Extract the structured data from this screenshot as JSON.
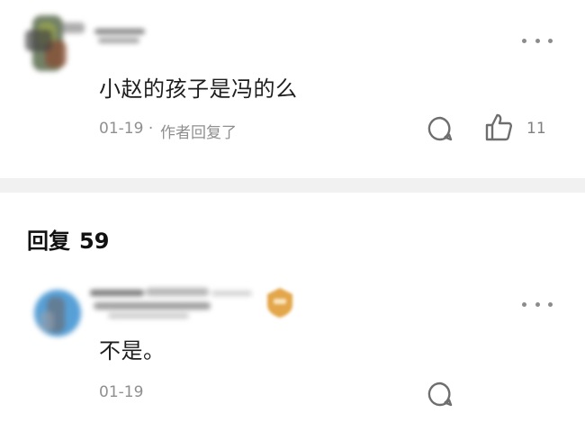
{
  "comment": {
    "text": "小赵的孩子是冯的么",
    "date": "01-19",
    "separator": "·",
    "author_reply_note": "作者回复了",
    "like_count": "11",
    "icons": {
      "more": "more-dots-icon",
      "reply": "comment-bubble-icon",
      "like": "thumbs-up-icon"
    }
  },
  "replies_section": {
    "label": "回复",
    "count": "59"
  },
  "reply": {
    "text": "不是。",
    "date": "01-19",
    "icons": {
      "more": "more-dots-icon",
      "reply": "comment-bubble-icon",
      "badge": "badge-icon"
    }
  },
  "colors": {
    "text_primary": "#1e1e1e",
    "text_secondary": "#8f8f8f",
    "divider": "#f1f1f1",
    "avatar1_blur": "#6d7f5a",
    "avatar2_blur": "#3a8fd0",
    "badge": "#e3a64a"
  }
}
